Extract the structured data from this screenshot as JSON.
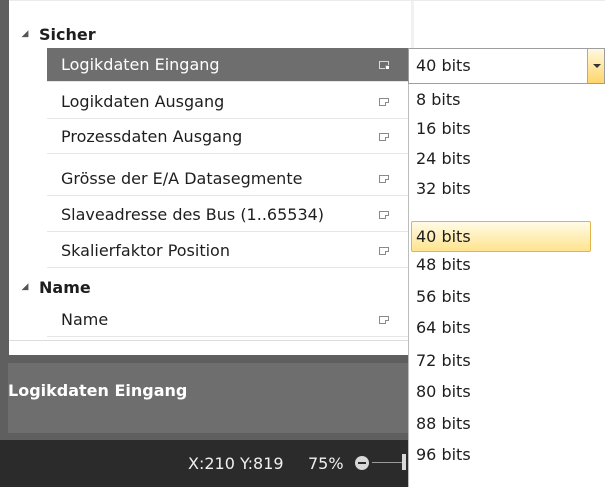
{
  "categories": [
    {
      "label": "Sicher",
      "properties": [
        {
          "label": "Logikdaten Eingang"
        },
        {
          "label": "Logikdaten Ausgang"
        },
        {
          "label": "Prozessdaten Ausgang"
        },
        {
          "label": "Grösse der E/A Datasegmente"
        },
        {
          "label": "Slaveadresse des Bus (1..65534)"
        },
        {
          "label": "Skalierfaktor Position"
        }
      ]
    },
    {
      "label": "Name",
      "properties": [
        {
          "label": "Name"
        }
      ]
    }
  ],
  "selected_property": "Logikdaten Eingang",
  "combo": {
    "value": "40 bits",
    "options": [
      "8 bits",
      "16 bits",
      "24 bits",
      "32 bits",
      "40 bits",
      "48 bits",
      "56 bits",
      "64 bits",
      "72 bits",
      "80 bits",
      "88 bits",
      "96 bits"
    ],
    "highlighted": "40 bits"
  },
  "description": {
    "title": "Logikdaten Eingang"
  },
  "statusbar": {
    "coords": "X:210 Y:819",
    "zoom": "75%"
  },
  "colors": {
    "accent_highlight": "#ffe38e",
    "selection": "#6e6e6e",
    "statusbar": "#2b2b2b"
  }
}
